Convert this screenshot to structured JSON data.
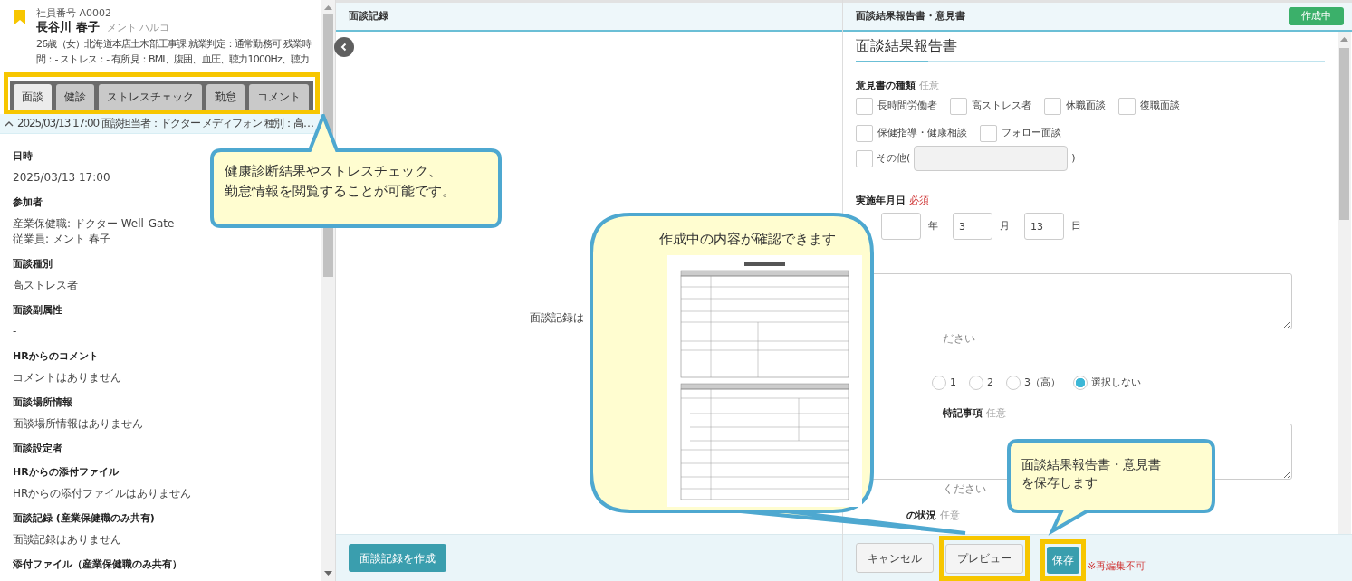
{
  "profile": {
    "employee_no": "社員番号 A0002",
    "name": "長谷川 春子",
    "kana": "メント ハルコ",
    "bookmarked": true,
    "info_lines": [
      "26歳（女）北海道本店土木部工事課 就業判定：通常勤務可 残業時",
      "間：- ストレス：- 有所見：BMI、腹囲、血圧、聴力1000Hz、聴力"
    ]
  },
  "tabs": [
    {
      "label": "面談",
      "selected": true
    },
    {
      "label": "健診",
      "selected": false
    },
    {
      "label": "ストレスチェック",
      "selected": false
    },
    {
      "label": "勤怠",
      "selected": false
    },
    {
      "label": "コメント",
      "selected": false
    }
  ],
  "interview_row": {
    "expanded": true,
    "text": "2025/03/13 17:00 面談担当者：ドクター メディフォン 種別：高…"
  },
  "details": [
    {
      "label": "日時",
      "values": [
        "2025/03/13 17:00"
      ]
    },
    {
      "label": "参加者",
      "values": [
        "産業保健職: ドクター Well-Gate",
        "従業員: メント 春子"
      ]
    },
    {
      "label": "面談種別",
      "values": [
        "高ストレス者"
      ]
    },
    {
      "label": "面談副属性",
      "values": [
        "-"
      ]
    },
    {
      "label": "HRからのコメント",
      "values": [
        "コメントはありません"
      ]
    },
    {
      "label": "面談場所情報",
      "values": [
        "面談場所情報はありません"
      ]
    },
    {
      "label": "面談設定者"
    },
    {
      "label": "HRからの添付ファイル",
      "values": [
        "HRからの添付ファイルはありません"
      ]
    },
    {
      "label": "面談記録 (産業保健職のみ共有)",
      "values": [
        "面談記録はありません"
      ]
    },
    {
      "label": "添付ファイル（産業保健職のみ共有）"
    }
  ],
  "record_panel": {
    "title": "面談記録",
    "empty_text": "面談記録は",
    "create_button": "面談記録を作成"
  },
  "report_panel": {
    "header": "面談結果報告書・意見書",
    "status": "作成中",
    "title": "面談結果報告書",
    "opinion_type": {
      "label": "意見書の種類",
      "tag": "任意",
      "options": [
        {
          "label": "長時間労働者",
          "checked": false
        },
        {
          "label": "高ストレス者",
          "checked": false
        },
        {
          "label": "休職面談",
          "checked": false
        },
        {
          "label": "復職面談",
          "checked": false
        },
        {
          "label": "保健指導・健康相談",
          "checked": false
        },
        {
          "label": "フォロー面談",
          "checked": false
        }
      ],
      "other": {
        "label": "その他(",
        "close": ")",
        "checked": false
      }
    },
    "date": {
      "label": "実施年月日",
      "tag": "必須",
      "parts": [
        {
          "unit": "年"
        },
        {
          "value": "3",
          "unit": "月"
        },
        {
          "value": "13",
          "unit": "日"
        }
      ]
    },
    "remarks_hint": "ださい",
    "level_options": [
      {
        "label": "1",
        "selected": false
      },
      {
        "label": "2",
        "selected": false
      },
      {
        "label": "3（高）",
        "selected": false
      },
      {
        "label": "選択しない",
        "selected": true
      }
    ],
    "notes": {
      "label": "特記事項",
      "tag": "任意",
      "hint": "ください"
    },
    "situation": {
      "label": "の状況",
      "tag": "任意"
    },
    "cancel_button": "キャンセル",
    "preview_button": "プレビュー",
    "save_button": "保存",
    "save_note": "※再編集不可"
  },
  "callouts": [
    {
      "kind": "tabs",
      "lines": [
        "健康診断結果やストレスチェック、",
        "勤怠情報を閲覧することが可能です。"
      ]
    },
    {
      "kind": "preview",
      "lines": [
        "作成中の内容が確認できます"
      ]
    },
    {
      "kind": "save",
      "lines": [
        "面談結果報告書・意見書",
        "を保存します"
      ]
    }
  ]
}
